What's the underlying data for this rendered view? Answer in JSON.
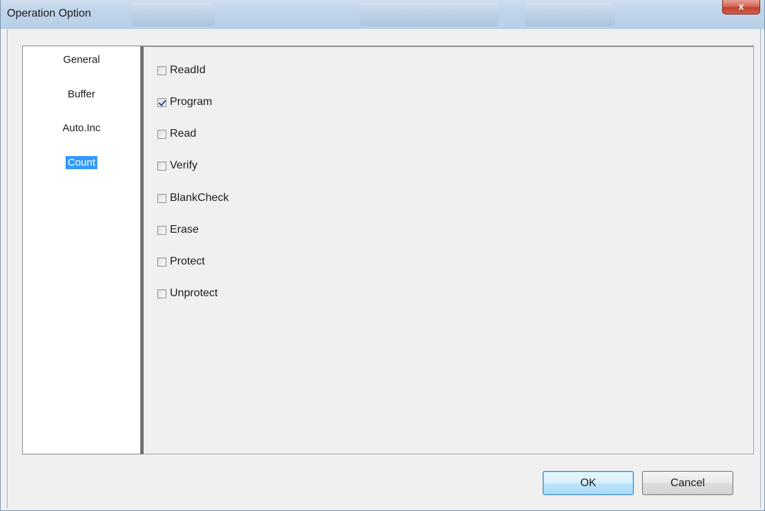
{
  "window": {
    "title": "Operation Option",
    "close_glyph": "x"
  },
  "nav": {
    "items": [
      {
        "label": "General",
        "selected": false
      },
      {
        "label": "Buffer",
        "selected": false
      },
      {
        "label": "Auto.Inc",
        "selected": false
      },
      {
        "label": "Count",
        "selected": true
      }
    ]
  },
  "options": [
    {
      "label": "ReadId",
      "checked": false
    },
    {
      "label": "Program",
      "checked": true
    },
    {
      "label": "Read",
      "checked": false
    },
    {
      "label": "Verify",
      "checked": false
    },
    {
      "label": "BlankCheck",
      "checked": false
    },
    {
      "label": "Erase",
      "checked": false
    },
    {
      "label": "Protect",
      "checked": false
    },
    {
      "label": "Unprotect",
      "checked": false
    }
  ],
  "buttons": {
    "ok_label": "OK",
    "cancel_label": "Cancel"
  },
  "colors": {
    "selection": "#3399ff",
    "titlebar": "#bfd4ea",
    "close": "#c7473a"
  }
}
